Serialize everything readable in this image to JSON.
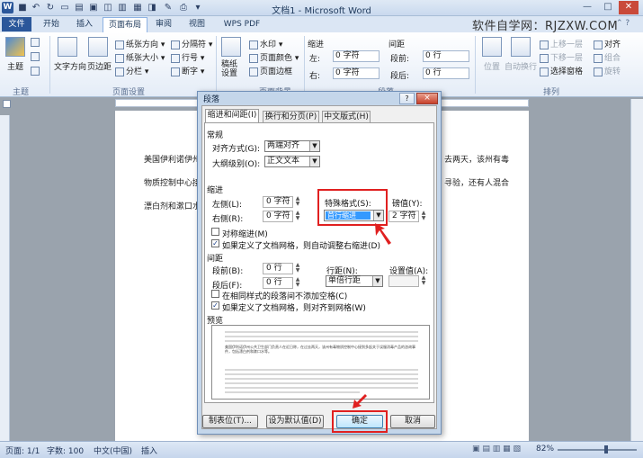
{
  "window": {
    "title": "文档1 - Microsoft Word",
    "app_icon": "W",
    "watermark": "软件自学网：RJZXW.COM"
  },
  "tabs": [
    "文件",
    "开始",
    "插入",
    "页面布局",
    "审阅",
    "视图",
    "WPS PDF"
  ],
  "ribbon": {
    "theme": {
      "label": "主题"
    },
    "text_direction": "文字方向",
    "margins": "页边距",
    "orientation": "纸张方向",
    "size": "纸张大小",
    "columns": "分栏",
    "breaks": "分隔符",
    "line_numbers": "行号",
    "hyphenation": "断字",
    "manuscript": "稿纸设置",
    "watermark": "水印",
    "page_color": "页面颜色",
    "page_border": "页面边框",
    "indent": {
      "title": "缩进",
      "left_label": "左:",
      "left_value": "0 字符",
      "right_label": "右:",
      "right_value": "0 字符"
    },
    "spacing": {
      "title": "间距",
      "before_label": "段前:",
      "before_value": "0 行",
      "after_label": "段后:",
      "after_value": "0 行"
    },
    "position": "位置",
    "wrap": "自动换行",
    "bring_forward": "上移一层",
    "send_backward": "下移一层",
    "selection_pane": "选择窗格",
    "align": "对齐",
    "group": "组合",
    "rotate": "旋转",
    "group_labels": {
      "themes": "主题",
      "page_setup": "页面设置",
      "page_background": "页面背景",
      "paragraph": "段落",
      "arrange": "排列"
    }
  },
  "document": {
    "lines": [
      "美国伊利诺伊州",
      "物质控制中心接",
      "漂白剂和漱口水"
    ],
    "right_fragments": [
      "去两天，该州有毒",
      "寻验，还有人混合"
    ]
  },
  "dialog": {
    "title": "段落",
    "help": "?",
    "close": "×",
    "tabs": [
      "缩进和间距(I)",
      "换行和分页(P)",
      "中文版式(H)"
    ],
    "general": {
      "section": "常规",
      "alignment_label": "对齐方式(G):",
      "alignment_value": "两端对齐",
      "outline_label": "大纲级别(O):",
      "outline_value": "正文文本"
    },
    "indent": {
      "section": "缩进",
      "left_label": "左侧(L):",
      "left_value": "0 字符",
      "right_label": "右侧(R):",
      "right_value": "0 字符",
      "special_label": "特殊格式(S):",
      "special_value": "首行缩进",
      "by_label": "磅值(Y):",
      "by_value": "2 字符",
      "mirror_label": "对称缩进(M)",
      "auto_adjust_label": "如果定义了文档网格，则自动调整右缩进(D)"
    },
    "spacing": {
      "section": "间距",
      "before_label": "段前(B):",
      "before_value": "0 行",
      "after_label": "段后(F):",
      "after_value": "0 行",
      "line_label": "行距(N):",
      "line_value": "单倍行距",
      "at_label": "设置值(A):",
      "no_space_label": "在相同样式的段落间不添加空格(C)",
      "snap_label": "如果定义了文档网格，则对齐到网格(W)"
    },
    "preview": {
      "section": "预览",
      "sample": "美国伊利诺伊州公共卫生部门负责人在近日称，在过去两天，该州有毒物质控制中心接到多起关于误服消毒产品的咨询事件，包括漂白剂和漱口水等。"
    },
    "buttons": {
      "tabs": "制表位(T)...",
      "default": "设为默认值(D)",
      "ok": "确定",
      "cancel": "取消"
    }
  },
  "status": {
    "page": "页面: 1/1",
    "words": "字数: 100",
    "lang": "中文(中国)",
    "mode": "插入",
    "zoom": "82%"
  },
  "colors": {
    "accent": "#2b579a",
    "highlight": "#e02020",
    "selection": "#3399ff"
  }
}
